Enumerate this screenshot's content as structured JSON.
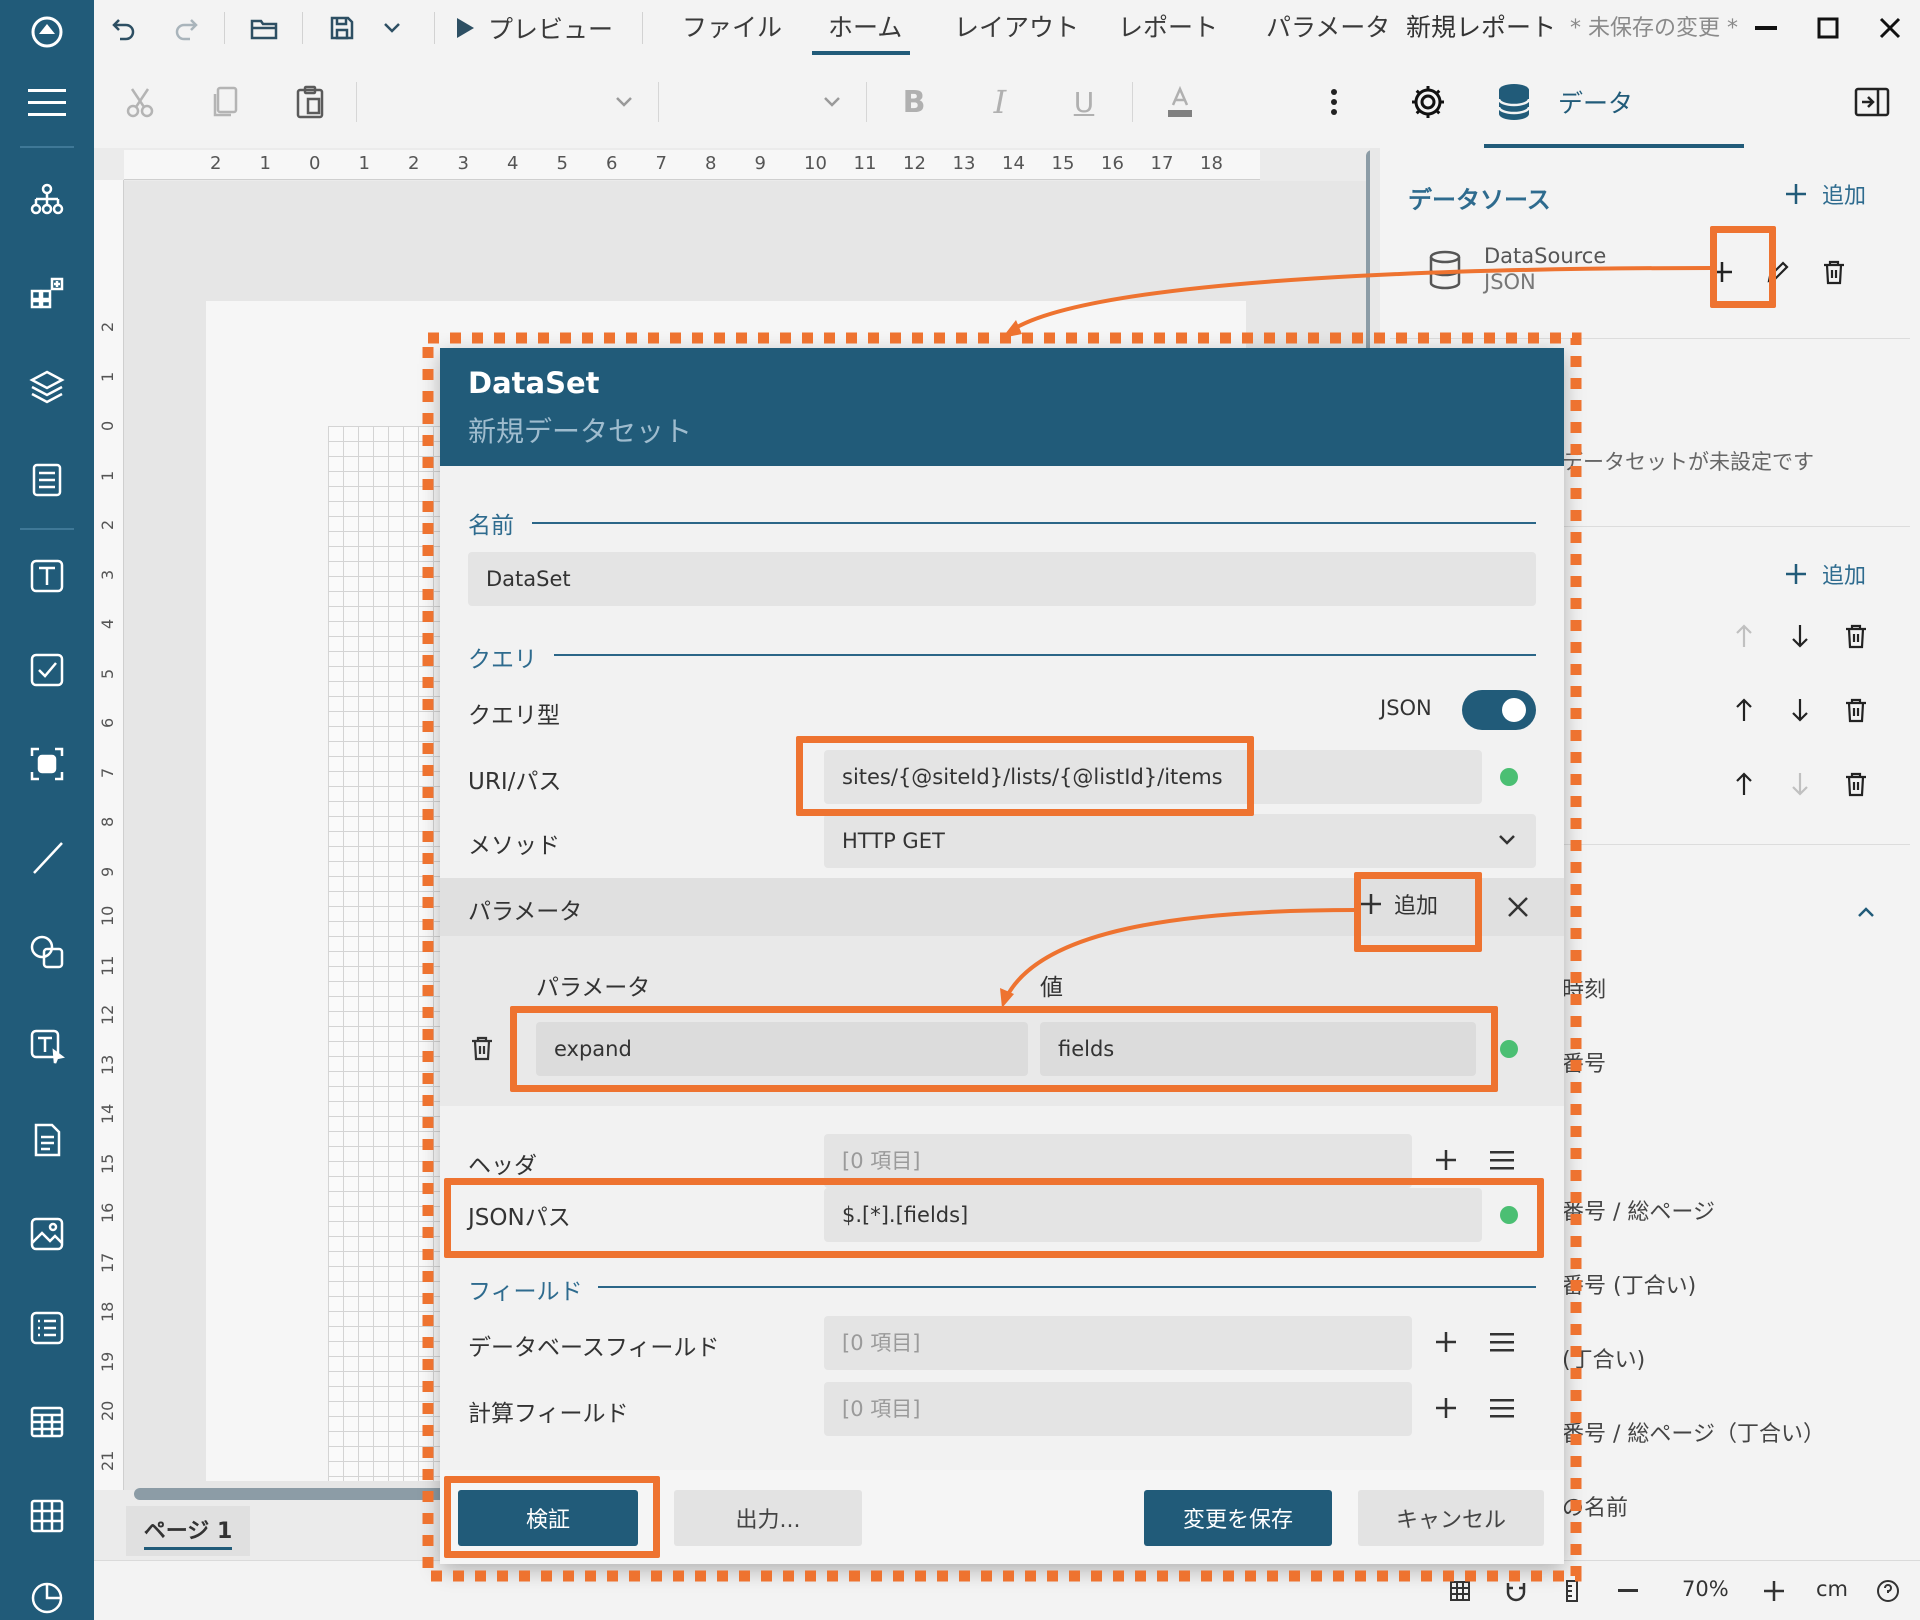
{
  "titlebar": {
    "preview": "プレビュー",
    "menu": [
      "ファイル",
      "ホーム",
      "レイアウト",
      "レポート",
      "パラメータ"
    ],
    "active_tab": "ホーム",
    "report_name": "新規レポート",
    "unsaved": "* 未保存の変更 *"
  },
  "toolbar": {
    "data_tab": "データ"
  },
  "ruler": {
    "h_ticks": [
      "2",
      "1",
      "0",
      "1",
      "2",
      "3",
      "4",
      "5",
      "6",
      "7",
      "8",
      "9",
      "10",
      "11",
      "12",
      "13",
      "14",
      "15",
      "16",
      "17",
      "18"
    ],
    "v_ticks": [
      "2",
      "1",
      "0",
      "1",
      "2",
      "3",
      "4",
      "5",
      "6",
      "7",
      "8",
      "9",
      "10",
      "11",
      "12",
      "13",
      "14",
      "15",
      "16",
      "17",
      "18",
      "19",
      "20",
      "21"
    ]
  },
  "page_tab": "ページ 1",
  "right_panel": {
    "datasource_title": "データソース",
    "add_label": "追加",
    "datasource_name": "DataSource",
    "datasource_type": "JSON",
    "dataset_empty": "データセットが未設定です",
    "add_label2": "追加",
    "list_items": [
      "時刻",
      "番号",
      "",
      "番号 / 総ページ",
      "番号 (丁合い)",
      "(丁合い)",
      "番号 / 総ページ（丁合い）",
      "の名前"
    ]
  },
  "dialog": {
    "title": "DataSet",
    "subtitle": "新規データセット",
    "name_section": "名前",
    "name_value": "DataSet",
    "query_section": "クエリ",
    "query_type_label": "クエリ型",
    "query_type_value": "JSON",
    "uri_label": "URI/パス",
    "uri_value": "sites/{@siteId}/lists/{@listId}/items",
    "method_label": "メソッド",
    "method_value": "HTTP GET",
    "params_label": "パラメータ",
    "params_add": "追加",
    "params_col_name": "パラメータ",
    "params_col_value": "値",
    "param_name": "expand",
    "param_value": "fields",
    "headers_label": "ヘッダ",
    "headers_value": "[0 項目]",
    "jsonpath_label": "JSONパス",
    "jsonpath_value": "$.[*].[fields]",
    "fields_section": "フィールド",
    "db_fields_label": "データベースフィールド",
    "db_fields_value": "[0 項目]",
    "calc_fields_label": "計算フィールド",
    "calc_fields_value": "[0 項目]",
    "btn_validate": "検証",
    "btn_output": "出力...",
    "btn_save": "変更を保存",
    "btn_cancel": "キャンセル"
  },
  "status": {
    "zoom": "70%",
    "unit": "cm"
  },
  "colors": {
    "primary": "#215b79",
    "callout": "#ee7330",
    "ok": "#4bbf73"
  }
}
